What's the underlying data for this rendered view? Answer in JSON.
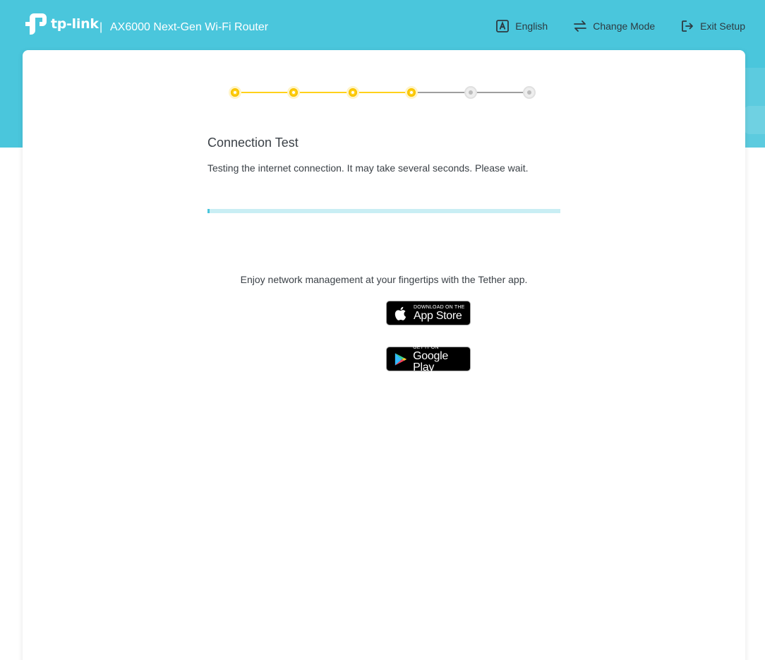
{
  "brand": {
    "logo_text": "tp-link",
    "separator": "|",
    "product_name": "AX6000 Next-Gen Wi-Fi Router"
  },
  "nav": {
    "language_label": "English",
    "change_mode_label": "Change Mode",
    "exit_setup_label": "Exit Setup"
  },
  "wizard": {
    "total_steps": 6,
    "completed_steps": 4,
    "title": "Connection Test",
    "description": "Testing the internet connection. It may take several seconds. Please wait.",
    "progress_fraction": 0.006
  },
  "tether": {
    "promo_text": "Enjoy network management at your fingertips with the Tether app.",
    "app_store_small": "DOWNLOAD ON THE",
    "app_store_big": "App Store",
    "google_play_small": "GET IT ON",
    "google_play_big": "Google Play"
  },
  "colors": {
    "header_bg": "#4ac6dc",
    "step_active": "#ffd11a",
    "step_inactive": "#bdbdbd",
    "progress_fill": "#4ac6dc",
    "progress_track": "#c9eef4"
  }
}
